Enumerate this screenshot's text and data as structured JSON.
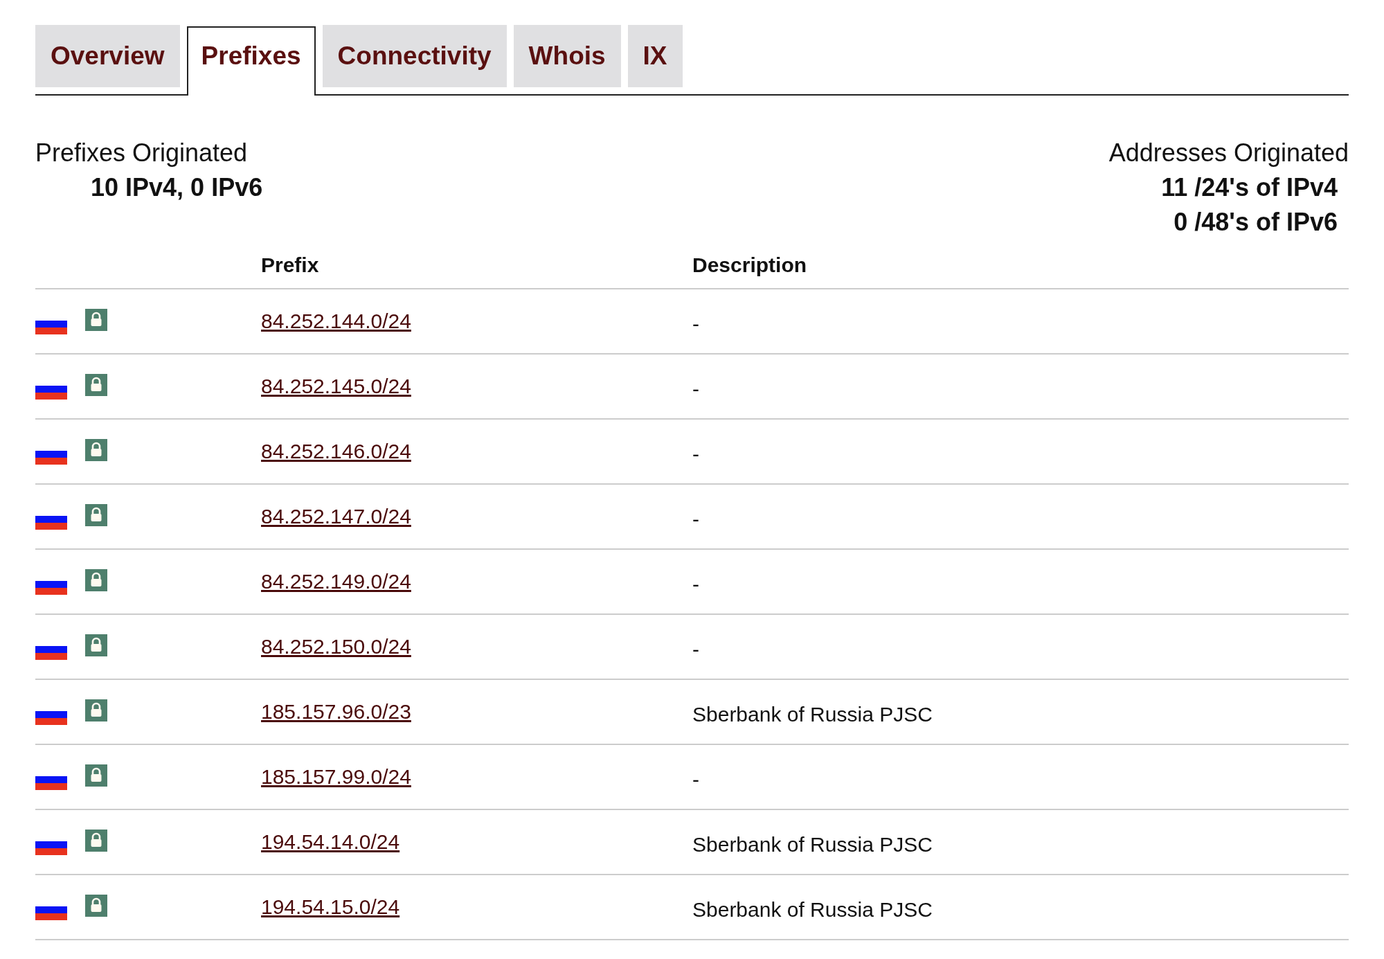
{
  "tabs": [
    {
      "label": "Overview",
      "selected": false
    },
    {
      "label": "Prefixes",
      "selected": true
    },
    {
      "label": "Connectivity",
      "selected": false
    },
    {
      "label": "Whois",
      "selected": false
    },
    {
      "label": "IX",
      "selected": false
    }
  ],
  "summary": {
    "prefixes": {
      "title": "Prefixes Originated",
      "lines": [
        "10 IPv4, 0 IPv6"
      ]
    },
    "addresses": {
      "title": "Addresses Originated",
      "lines": [
        "11 /24's of IPv4",
        "0 /48's of IPv6"
      ]
    }
  },
  "table": {
    "columns": [
      "Prefix",
      "Description"
    ],
    "rows": [
      {
        "prefix": "84.252.144.0/24",
        "description": "-"
      },
      {
        "prefix": "84.252.145.0/24",
        "description": "-"
      },
      {
        "prefix": "84.252.146.0/24",
        "description": "-"
      },
      {
        "prefix": "84.252.147.0/24",
        "description": "-"
      },
      {
        "prefix": "84.252.149.0/24",
        "description": "-"
      },
      {
        "prefix": "84.252.150.0/24",
        "description": "-"
      },
      {
        "prefix": "185.157.96.0/23",
        "description": "Sberbank of Russia PJSC"
      },
      {
        "prefix": "185.157.99.0/24",
        "description": "-"
      },
      {
        "prefix": "194.54.14.0/24",
        "description": "Sberbank of Russia PJSC"
      },
      {
        "prefix": "194.54.15.0/24",
        "description": "Sberbank of Russia PJSC"
      }
    ]
  }
}
